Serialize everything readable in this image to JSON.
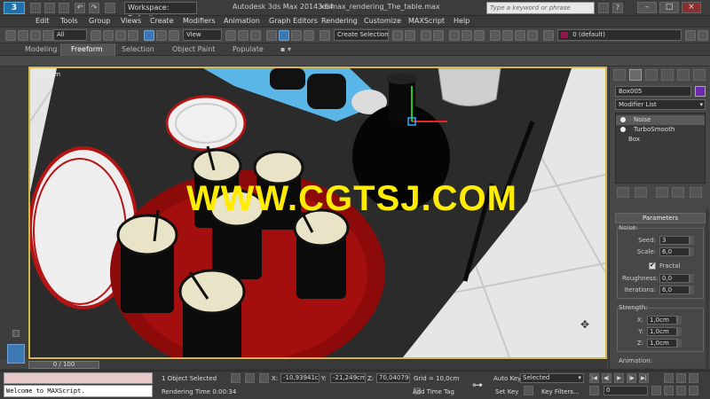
{
  "titlebar": {
    "workspace": "Workspace: Default",
    "app_title": "Autodesk 3ds Max 2014 x64",
    "doc_title": "3dsmax_rendering_The_table.max",
    "search_placeholder": "Type a keyword or phrase"
  },
  "menu": [
    "Edit",
    "Tools",
    "Group",
    "Views",
    "Create",
    "Modifiers",
    "Animation",
    "Graph Editors",
    "Rendering",
    "Customize",
    "MAXScript",
    "Help"
  ],
  "toolbar": {
    "selection_filter": "All",
    "reference_coord": "View",
    "named_selection": "Create Selection Se",
    "layer": "0 (default)"
  },
  "ribbon": {
    "tabs": [
      "Modeling",
      "Freeform",
      "Selection",
      "Object Paint",
      "Populate"
    ],
    "active_tab": "Freeform"
  },
  "viewport": {
    "label": "[+][Cam",
    "watermark": "WWW.CGTSJ.COM",
    "colors": {
      "border": "#d6b74a",
      "watermark": "#ffec00",
      "tray": "#9b0c0c"
    }
  },
  "command_panel": {
    "object_name": "Box005",
    "object_color": "#6b2ab0",
    "modifier_list": "Modifier List",
    "stack": [
      "Noise",
      "TurboSmooth",
      "Box"
    ],
    "rollout_title": "Parameters",
    "noise_group": "Noise:",
    "seed_label": "Seed:",
    "seed_value": "3",
    "scale_label": "Scale:",
    "scale_value": "6,0",
    "fractal_label": "Fractal",
    "fractal_checked": true,
    "roughness_label": "Roughness:",
    "roughness_value": "0,0",
    "iterations_label": "Iterations:",
    "iterations_value": "6,0",
    "strength_group": "Strength:",
    "x_label": "X:",
    "x_value": "1,0cm",
    "y_label": "Y:",
    "y_value": "1,0cm",
    "z_label": "Z:",
    "z_value": "1,0cm",
    "animation_group": "Animation:"
  },
  "timeline": {
    "slider": "0 / 100"
  },
  "status": {
    "listener_text": "Welcome to MAXScript.",
    "selection_info": "1 Object Selected",
    "rendering_time": "Rendering Time  0:00:34",
    "x_label": "X:",
    "x_value": "-10,93941c",
    "y_label": "Y:",
    "y_value": "-21,249cm",
    "z_label": "Z:",
    "z_value": "70,04079c",
    "grid": "Grid = 10,0cm",
    "add_time_tag": "Add Time Tag",
    "auto_key": "Auto Key",
    "set_key": "Set Key",
    "key_mode": "Selected",
    "key_filters": "Key Filters...",
    "frame": "0"
  }
}
